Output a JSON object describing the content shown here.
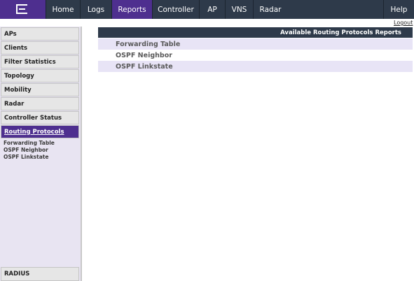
{
  "nav": {
    "tabs": [
      "Home",
      "Logs",
      "Reports",
      "Controller",
      "AP",
      "VNS",
      "Radar"
    ],
    "active_tab": "Reports",
    "help_label": "Help",
    "logout_label": "Logout"
  },
  "sidebar": {
    "items": [
      "APs",
      "Clients",
      "Filter Statistics",
      "Topology",
      "Mobility",
      "Radar",
      "Controller Status",
      "Routing Protocols"
    ],
    "active_item": "Routing Protocols",
    "subitems": [
      "Forwarding Table",
      "OSPF Neighbor",
      "OSPF Linkstate"
    ],
    "bottom_item": "RADIUS"
  },
  "main": {
    "header": "Available Routing Protocols Reports",
    "rows": [
      "Forwarding Table",
      "OSPF Neighbor",
      "OSPF Linkstate"
    ]
  },
  "colors": {
    "brand_purple": "#4e2f8f",
    "nav_dark": "#2e3a4a",
    "row_shade": "#e8e4f6"
  }
}
